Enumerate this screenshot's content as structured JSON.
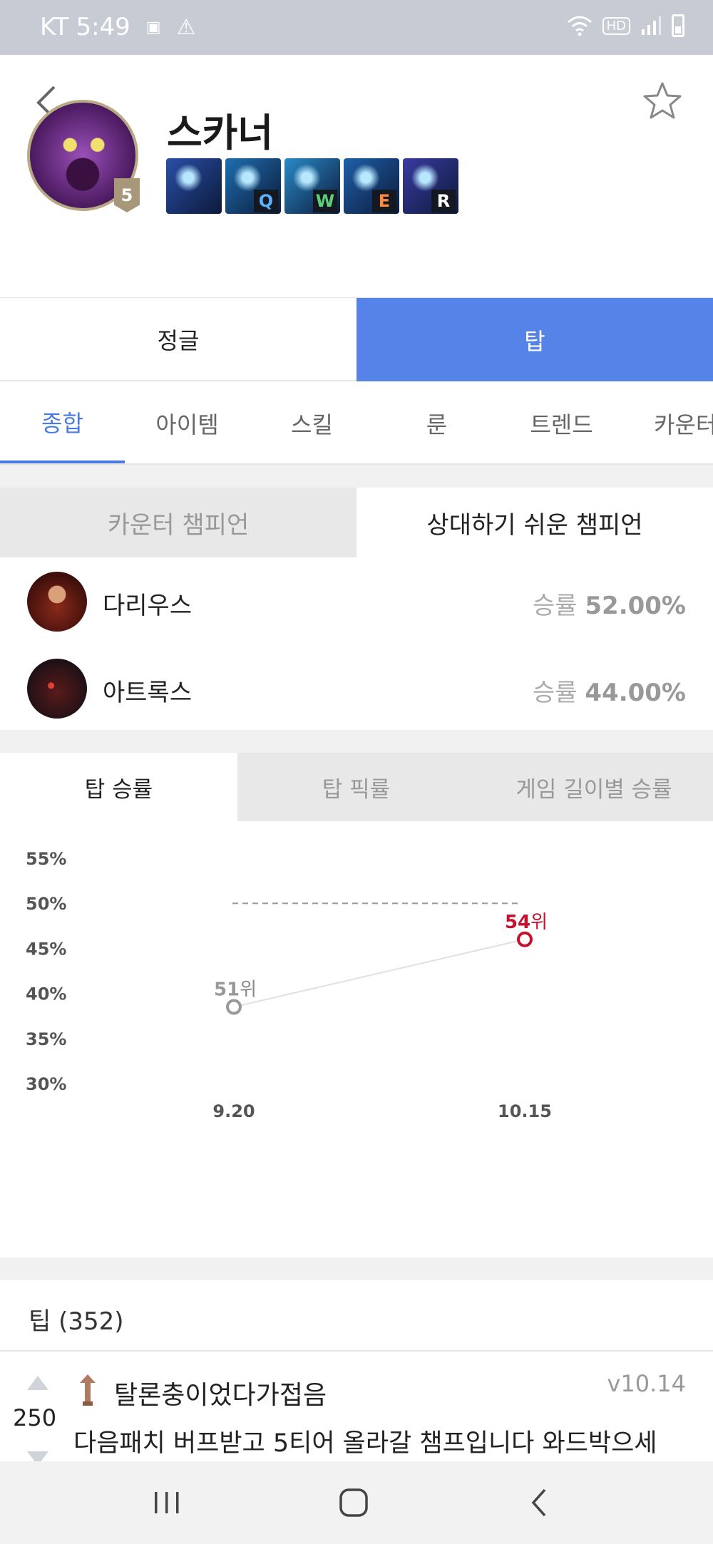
{
  "status_bar": {
    "carrier": "KT",
    "time": "5:49",
    "hd": "HD"
  },
  "champion": {
    "name": "스카너",
    "level_badge": "5",
    "skills": [
      {
        "key": "",
        "icon": "passive-icon",
        "color": "#2a4fa8"
      },
      {
        "key": "Q",
        "icon": "skill-q-icon",
        "color": "#1f6fb0"
      },
      {
        "key": "W",
        "icon": "skill-w-icon",
        "color": "#2a8ac8"
      },
      {
        "key": "E",
        "icon": "skill-e-icon",
        "color": "#1f5fa8"
      },
      {
        "key": "R",
        "icon": "skill-r-icon",
        "color": "#3a3aa0"
      }
    ]
  },
  "position_tabs": [
    {
      "label": "정글",
      "active": false
    },
    {
      "label": "탑",
      "active": true
    }
  ],
  "sub_tabs": [
    {
      "label": "종합",
      "active": true
    },
    {
      "label": "아이템",
      "active": false
    },
    {
      "label": "스킬",
      "active": false
    },
    {
      "label": "룬",
      "active": false
    },
    {
      "label": "트렌드",
      "active": false
    },
    {
      "label": "카운터",
      "active": false
    }
  ],
  "counter_tabs": [
    {
      "label": "카운터 챔피언",
      "active": false
    },
    {
      "label": "상대하기 쉬운 챔피언",
      "active": true
    }
  ],
  "counters": [
    {
      "name": "다리우스",
      "rate_label": "승률",
      "rate_value": "52.00%"
    },
    {
      "name": "아트록스",
      "rate_label": "승률",
      "rate_value": "44.00%"
    }
  ],
  "stat_tabs": [
    {
      "label": "탑 승률",
      "active": true
    },
    {
      "label": "탑 픽률",
      "active": false
    },
    {
      "label": "게임 길이별 승률",
      "active": false
    }
  ],
  "chart_data": {
    "type": "line",
    "title": "",
    "xlabel": "",
    "ylabel": "",
    "categories": [
      "9.20",
      "10.15"
    ],
    "values": [
      38.5,
      46
    ],
    "point_labels": [
      {
        "rank": "51",
        "suffix": "위"
      },
      {
        "rank": "54",
        "suffix": "위"
      }
    ],
    "y_ticks": [
      "55%",
      "50%",
      "45%",
      "40%",
      "35%",
      "30%"
    ],
    "ylim": [
      30,
      55
    ],
    "reference_line": 50,
    "colors": {
      "first_point": "#999999",
      "last_point": "#c8102e",
      "line": "#e0e0e0"
    }
  },
  "tips": {
    "title": "팁 (352)",
    "items": [
      {
        "votes": "250",
        "author": "탈론충이었다가접음",
        "version": "v10.14",
        "text": "다음패치 버프받고 5티어 올라갈 챔프입니다 와드박으세"
      }
    ]
  }
}
